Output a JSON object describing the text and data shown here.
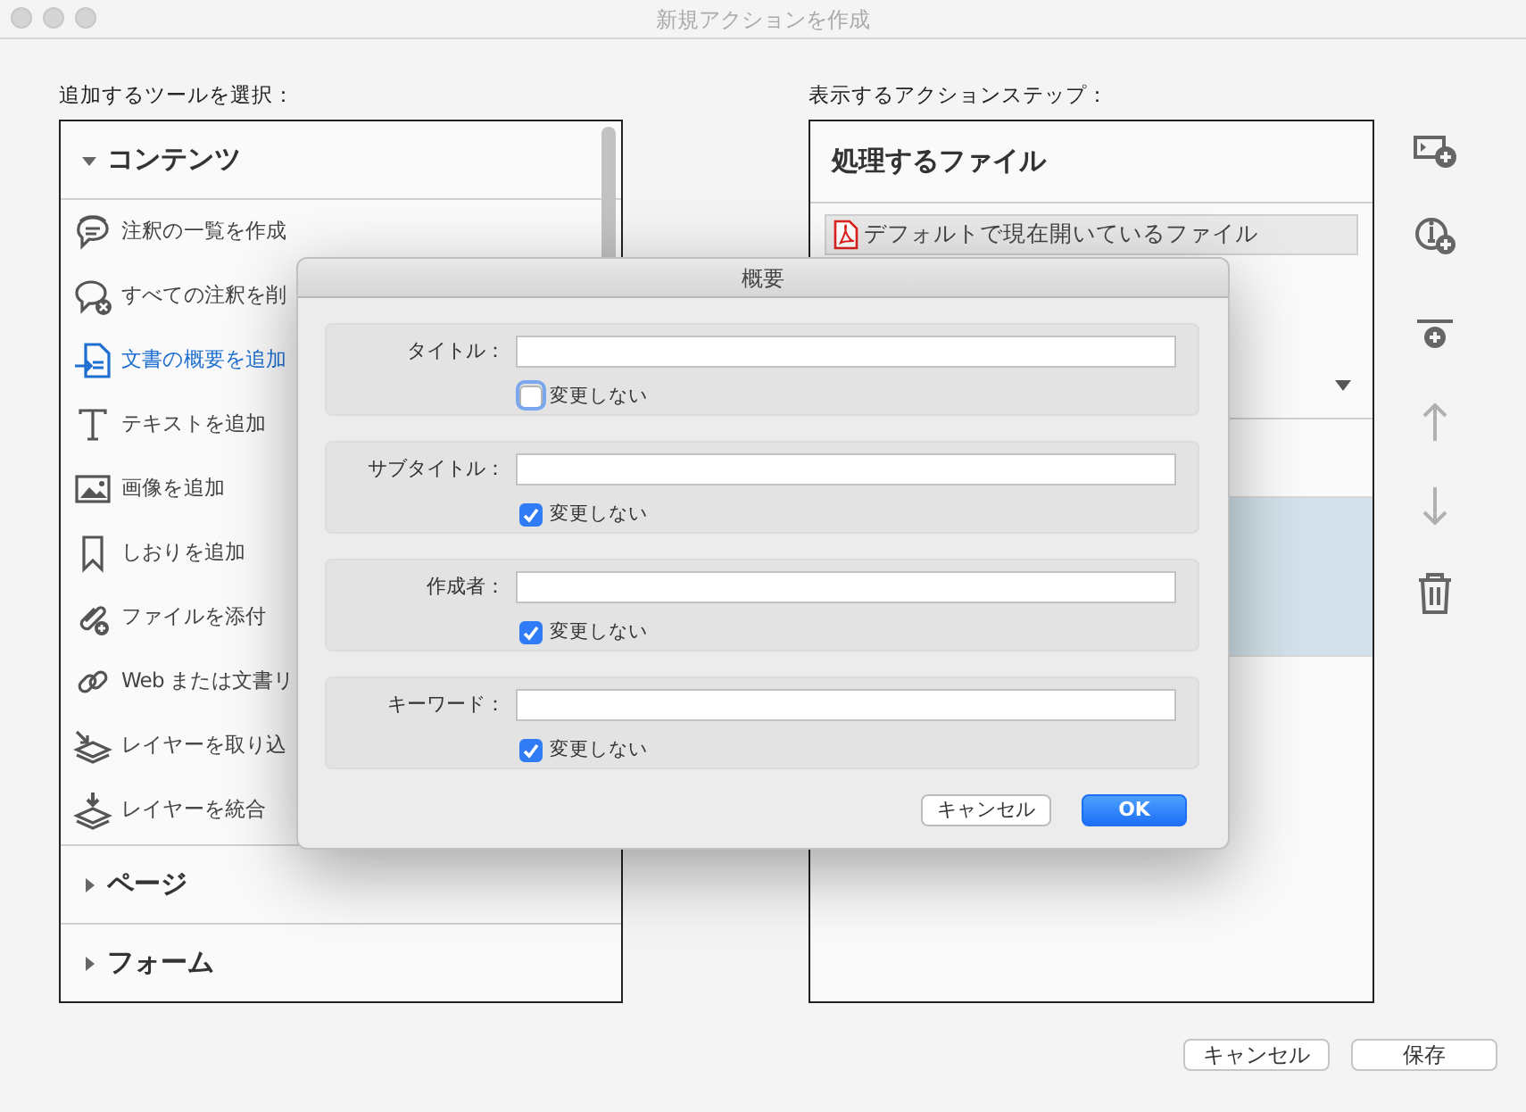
{
  "window": {
    "title": "新規アクションを作成"
  },
  "left_panel": {
    "label": "追加するツールを選択：",
    "sections": [
      {
        "title": "コンテンツ",
        "expanded": true,
        "items": [
          {
            "label": "注釈の一覧を作成",
            "selected": false
          },
          {
            "label": "すべての注釈を削",
            "selected": false
          },
          {
            "label": "文書の概要を追加",
            "selected": true
          },
          {
            "label": "テキストを追加",
            "selected": false
          },
          {
            "label": "画像を追加",
            "selected": false
          },
          {
            "label": "しおりを追加",
            "selected": false
          },
          {
            "label": "ファイルを添付",
            "selected": false
          },
          {
            "label": "Web または文書リ",
            "selected": false
          },
          {
            "label": "レイヤーを取り込",
            "selected": false
          },
          {
            "label": "レイヤーを統合",
            "selected": false
          }
        ]
      },
      {
        "title": "ページ",
        "expanded": false
      },
      {
        "title": "フォーム",
        "expanded": false
      }
    ]
  },
  "right_panel": {
    "label": "表示するアクションステップ：",
    "header": "処理するファイル",
    "file": "デフォルトで現在開いているファイル",
    "steps": [
      {
        "selected": false
      },
      {
        "selected": true
      }
    ]
  },
  "toolbar": [
    {
      "disabled": false
    },
    {
      "disabled": false
    },
    {
      "disabled": false
    },
    {
      "disabled": true
    },
    {
      "disabled": true
    },
    {
      "disabled": false
    }
  ],
  "footer_buttons": [
    "キャンセル",
    "保存"
  ],
  "dialog": {
    "title": "概要",
    "fields": [
      {
        "label": "タイトル：",
        "checkbox": "変更しない",
        "checked": false,
        "focused": true
      },
      {
        "label": "サブタイトル：",
        "checkbox": "変更しない",
        "checked": true,
        "focused": false
      },
      {
        "label": "作成者：",
        "checkbox": "変更しない",
        "checked": true,
        "focused": false
      },
      {
        "label": "キーワード：",
        "checkbox": "変更しない",
        "checked": true,
        "focused": false
      }
    ],
    "buttons": [
      {
        "label": "キャンセル",
        "kind": "default"
      },
      {
        "label": "OK",
        "kind": "primary"
      }
    ]
  }
}
